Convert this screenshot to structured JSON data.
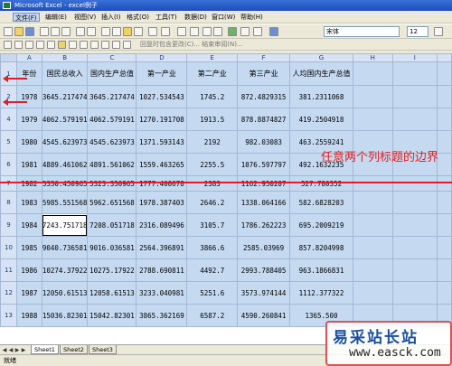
{
  "window": {
    "title": "Microsoft Excel - excel例子"
  },
  "menu": {
    "items": [
      "文件(F)",
      "编辑(E)",
      "视图(V)",
      "插入(I)",
      "格式(O)",
      "工具(T)",
      "数据(D)",
      "窗口(W)",
      "帮助(H)"
    ]
  },
  "toolbar": {
    "font_name": "宋体",
    "font_size": "12",
    "review_label": "回复时包含更改(C)...  结束审阅(N)..."
  },
  "grid": {
    "columns": [
      "A",
      "B",
      "C",
      "D",
      "E",
      "F",
      "G",
      "H",
      "I"
    ],
    "headers": [
      "年份",
      "国民总收入",
      "国内生产总值",
      "第一产业",
      "第二产业",
      "第三产业",
      "人均国内生产总值"
    ],
    "rows": [
      {
        "n": "1",
        "kind": "hdr"
      },
      {
        "n": "2",
        "v": [
          "1978",
          "3645.217474",
          "3645.217474",
          "1027.534543",
          "1745.2",
          "872.4829315",
          "381.2311068"
        ]
      },
      {
        "n": "4",
        "v": [
          "1979",
          "4062.579191",
          "4062.579191",
          "1270.191708",
          "1913.5",
          "878.8874827",
          "419.2504918"
        ]
      },
      {
        "n": "5",
        "v": [
          "1980",
          "4545.623973",
          "4545.623973",
          "1371.593143",
          "2192",
          "982.03083",
          "463.2559241"
        ]
      },
      {
        "n": "6",
        "v": [
          "1981",
          "4889.461062",
          "4891.561062",
          "1559.463265",
          "2255.5",
          "1076.597797",
          "492.1632235"
        ]
      },
      {
        "n": "7",
        "v": [
          "1982",
          "5330.450965",
          "5323.350965",
          "1777.400678",
          "2383",
          "1162.950287",
          "527.780352"
        ]
      },
      {
        "n": "8",
        "v": [
          "1983",
          "5985.551568",
          "5962.651568",
          "1978.387403",
          "2646.2",
          "1338.064166",
          "582.6828203"
        ]
      },
      {
        "n": "9",
        "v": [
          "1984",
          "7243.751718",
          "7208.051718",
          "2316.089496",
          "3105.7",
          "1786.262223",
          "695.2009219"
        ]
      },
      {
        "n": "10",
        "v": [
          "1985",
          "9040.736581",
          "9016.036581",
          "2564.396891",
          "3866.6",
          "2585.03969",
          "857.8204998"
        ]
      },
      {
        "n": "11",
        "v": [
          "1986",
          "10274.37922",
          "10275.17922",
          "2788.690811",
          "4492.7",
          "2993.788405",
          "963.1866831"
        ]
      },
      {
        "n": "12",
        "v": [
          "1987",
          "12050.61513",
          "12058.61513",
          "3233.040981",
          "5251.6",
          "3573.974144",
          "1112.377322"
        ]
      },
      {
        "n": "13",
        "v": [
          "1988",
          "15036.82301",
          "15042.82301",
          "3865.362169",
          "6587.2",
          "4590.260841",
          "1365.500"
        ]
      }
    ]
  },
  "annotation": "任意两个列标题的边界",
  "sheets": [
    "Sheet1",
    "Sheet2",
    "Sheet3"
  ],
  "status": "就绪",
  "watermark": {
    "title": "易采站长站",
    "url": "www.easck.com"
  }
}
